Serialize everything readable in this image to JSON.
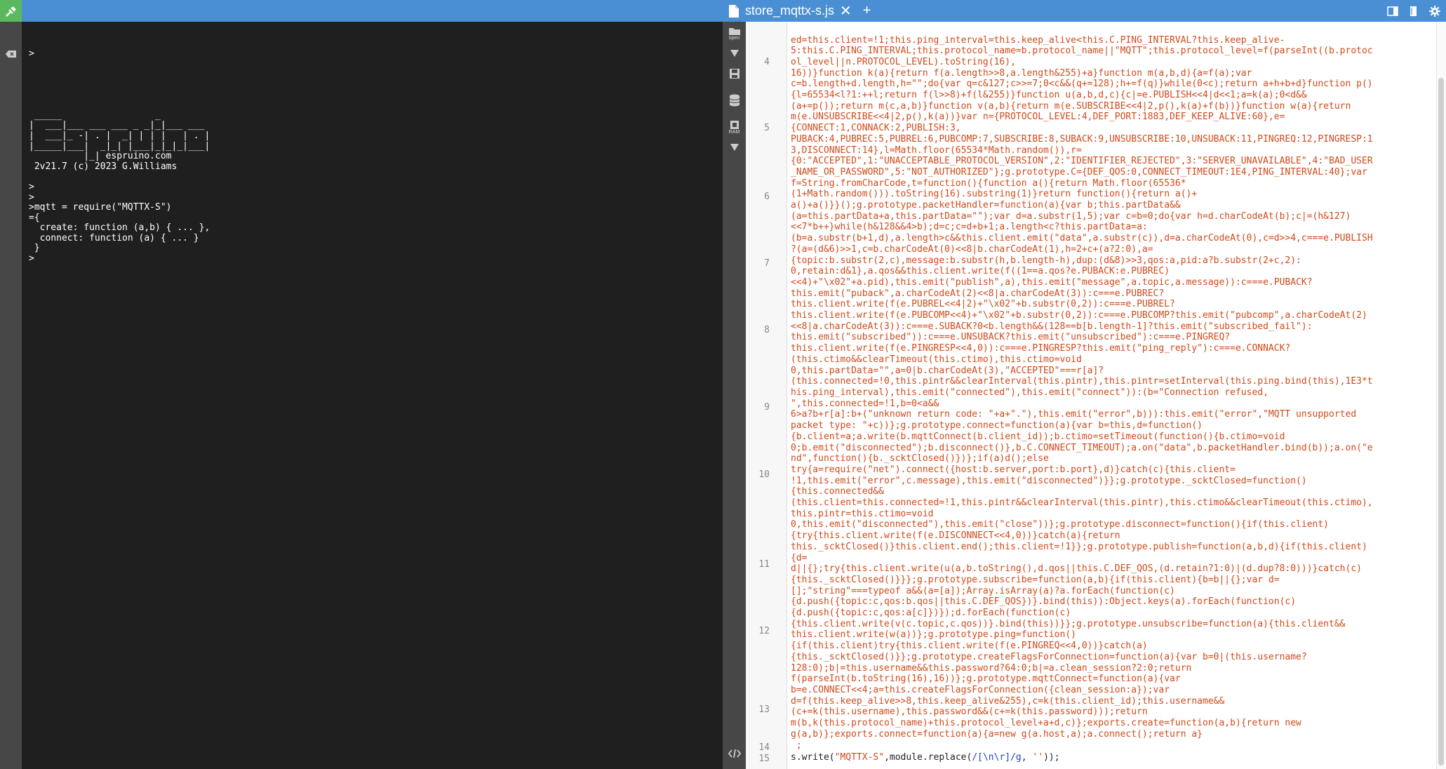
{
  "header": {
    "tab_title": "store_mqttx-s.js",
    "close_glyph": "✕",
    "add_glyph": "+"
  },
  "mid_toolbar": {
    "open_label": "open",
    "ram_label": "RAM"
  },
  "terminal": {
    "lines": [
      ">",
      "",
      "",
      "",
      "",
      "",
      " _____                 _",
      "|  ___|___ ___ ___ _ _|_|___ ___",
      "|  ___|_ -| . |  _| | | |   | . |",
      "|_____|___|  _|_| |___|_|_|_|___|",
      "          |_| espruino.com",
      " 2v21.7 (c) 2023 G.Williams",
      "",
      ">",
      ">",
      ">mqtt = require(\"MQTTX-S\")",
      "={",
      "  create: function (a,b) { ... },",
      "  connect: function (a) { ... }",
      " }",
      ">"
    ]
  },
  "editor": {
    "line_numbers": [
      "4",
      "5",
      "6",
      "7",
      "8",
      "9",
      "10",
      "11",
      "12",
      "13",
      "14",
      "15"
    ],
    "code_lines": [
      "ed=this.client=!1;this.ping_interval=this.keep_alive<this.C.PING_INTERVAL?this.keep_alive-",
      "5:this.C.PING_INTERVAL;this.protocol_name=b.protocol_name||\"MQTT\";this.protocol_level=f(parseInt((b.protoc",
      "ol_level||n.PROTOCOL_LEVEL).toString(16),",
      "16))}function k(a){return f(a.length>>8,a.length&255)+a}function m(a,b,d){a=f(a);var",
      "c=b.length+d.length,h=\"\";do{var q=c&127;c>>=7;0<c&&(q+=128);h+=f(q)}while(0<c);return a+h+b+d}function p()",
      "{l=65534<l?1:++l;return f(l>>8)+f(l&255)}function u(a,b,d,c){c|=e.PUBLISH<<4|d<<1;a=k(a);0<d&&",
      "(a+=p());return m(c,a,b)}function v(a,b){return m(e.SUBSCRIBE<<4|2,p(),k(a)+f(b))}function w(a){return",
      "m(e.UNSUBSCRIBE<<4|2,p(),k(a))}var n={PROTOCOL_LEVEL:4,DEF_PORT:1883,DEF_KEEP_ALIVE:60},e=",
      "{CONNECT:1,CONNACK:2,PUBLISH:3,",
      "PUBACK:4,PUBREC:5,PUBREL:6,PUBCOMP:7,SUBSCRIBE:8,SUBACK:9,UNSUBSCRIBE:10,UNSUBACK:11,PINGREQ:12,PINGRESP:1",
      "3,DISCONNECT:14},l=Math.floor(65534*Math.random()),r=",
      "{0:\"ACCEPTED\",1:\"UNACCEPTABLE_PROTOCOL_VERSION\",2:\"IDENTIFIER_REJECTED\",3:\"SERVER_UNAVAILABLE\",4:\"BAD_USER",
      "_NAME_OR_PASSWORD\",5:\"NOT_AUTHORIZED\"};g.prototype.C={DEF_QOS:0,CONNECT_TIMEOUT:1E4,PING_INTERVAL:40};var",
      "f=String.fromCharCode,t=function(){function a(){return Math.floor(65536*",
      "(1+Math.random())).toString(16).substring(1)}return function(){return a()+",
      "a()+a()}}();g.prototype.packetHandler=function(a){var b;this.partData&&",
      "(a=this.partData+a,this.partData=\"\");var d=a.substr(1,5);var c=b=0;do{var h=d.charCodeAt(b);c|=(h&127)",
      "<<7*b++}while(h&128&&4>b);d=c;c=d+b+1;a.length<c?this.partData=a:",
      "(b=a.substr(b+1,d),a.length>c&&this.client.emit(\"data\",a.substr(c)),d=a.charCodeAt(0),c=d>>4,c===e.PUBLISH",
      "?(a=(d&6)>>1,c=b.charCodeAt(0)<<8|b.charCodeAt(1),h=2+c+(a?2:0),a=",
      "{topic:b.substr(2,c),message:b.substr(h,b.length-h),dup:(d&8)>>3,qos:a,pid:a?b.substr(2+c,2):",
      "0,retain:d&1},a.qos&&this.client.write(f((1==a.qos?e.PUBACK:e.PUBREC)",
      "<<4)+\"\\x02\"+a.pid),this.emit(\"publish\",a),this.emit(\"message\",a.topic,a.message)):c===e.PUBACK?",
      "this.emit(\"puback\",a.charCodeAt(2)<<8|a.charCodeAt(3)):c===e.PUBREC?",
      "this.client.write(f(e.PUBREL<<4|2)+\"\\x02\"+b.substr(0,2)):c===e.PUBREL?",
      "this.client.write(f(e.PUBCOMP<<4)+\"\\x02\"+b.substr(0,2)):c===e.PUBCOMP?this.emit(\"pubcomp\",a.charCodeAt(2)",
      "<<8|a.charCodeAt(3)):c===e.SUBACK?0<b.length&&(128==b[b.length-1]?this.emit(\"subscribed_fail\"):",
      "this.emit(\"subscribed\")):c===e.UNSUBACK?this.emit(\"unsubscribed\"):c===e.PINGREQ?",
      "this.client.write(f(e.PINGRESP<<4,0)):c===e.PINGRESP?this.emit(\"ping_reply\"):c===e.CONNACK?",
      "(this.ctimo&&clearTimeout(this.ctimo),this.ctimo=void",
      "0,this.partData=\"\",a=0|b.charCodeAt(3),\"ACCEPTED\"===r[a]?",
      "(this.connected=!0,this.pintr&&clearInterval(this.pintr),this.pintr=setInterval(this.ping.bind(this),1E3*t",
      "his.ping_interval),this.emit(\"connected\"),this.emit(\"connect\")):(b=\"Connection refused,",
      "\",this.connected=!1,b=0<a&&",
      "6>a?b+r[a]:b+(\"unknown return code: \"+a+\".\"),this.emit(\"error\",b))):this.emit(\"error\",\"MQTT unsupported",
      "packet type: \"+c))};g.prototype.connect=function(a){var b=this,d=function()",
      "{b.client=a;a.write(b.mqttConnect(b.client_id));b.ctimo=setTimeout(function(){b.ctimo=void",
      "0;b.emit(\"disconnected\");b.disconnect()},b.C.CONNECT_TIMEOUT);a.on(\"data\",b.packetHandler.bind(b));a.on(\"e",
      "nd\",function(){b._scktClosed()})};if(a)d();else",
      "try{a=require(\"net\").connect({host:b.server,port:b.port},d)}catch(c){this.client=",
      "!1,this.emit(\"error\",c.message),this.emit(\"disconnected\")}};g.prototype._scktClosed=function()",
      "{this.connected&&",
      "(this.client=this.connected=!1,this.pintr&&clearInterval(this.pintr),this.ctimo&&clearTimeout(this.ctimo),",
      "this.pintr=this.ctimo=void",
      "0,this.emit(\"disconnected\"),this.emit(\"close\"))};g.prototype.disconnect=function(){if(this.client)",
      "{try{this.client.write(f(e.DISCONNECT<<4,0))}catch(a){return",
      "this._scktClosed()}this.client.end();this.client=!1}};g.prototype.publish=function(a,b,d){if(this.client)",
      "{d=",
      "d||{};try{this.client.write(u(a,b.toString(),d.qos||this.C.DEF_QOS,(d.retain?1:0)|(d.dup?8:0)))}catch(c)",
      "{this._scktClosed()}}};g.prototype.subscribe=function(a,b){if(this.client){b=b||{};var d=",
      "[];\"string\"===typeof a&&(a=[a]);Array.isArray(a)?a.forEach(function(c)",
      "{d.push({topic:c,qos:b.qos||this.C.DEF_QOS})}.bind(this)):Object.keys(a).forEach(function(c)",
      "{d.push({topic:c,qos:a[c]})});d.forEach(function(c)",
      "{this.client.write(v(c.topic,c.qos))}.bind(this))}};g.prototype.unsubscribe=function(a){this.client&&",
      "this.client.write(w(a))};g.prototype.ping=function()",
      "{if(this.client)try{this.client.write(f(e.PINGREQ<<4,0))}catch(a)",
      "{this._scktClosed()}};g.prototype.createFlagsForConnection=function(a){var b=0|(this.username?",
      "128:0);b|=this.username&&this.password?64:0;b|=a.clean_session?2:0;return",
      "f(parseInt(b.toString(16),16))};g.prototype.mqttConnect=function(a){var",
      "b=e.CONNECT<<4;a=this.createFlagsForConnection({clean_session:a});var",
      "d=f(this.keep_alive>>8,this.keep_alive&255),c=k(this.client_id);this.username&&",
      "(c+=k(this.username),this.password&&(c+=k(this.password)));return",
      "m(b,k(this.protocol_name)+this.protocol_level+a+d,c)};exports.create=function(a,b){return new",
      "g(a,b)};exports.connect=function(a){a=new g(a.host,a);a.connect();return a}",
      " ;"
    ],
    "last_line": {
      "pre": "s.write(",
      "str1": "\"MQTTX-S\"",
      "mid": ",module.replace(",
      "regex": "/[\\n\\r]/g",
      "sep": ", ",
      "str2": "''",
      "post": "));"
    }
  }
}
